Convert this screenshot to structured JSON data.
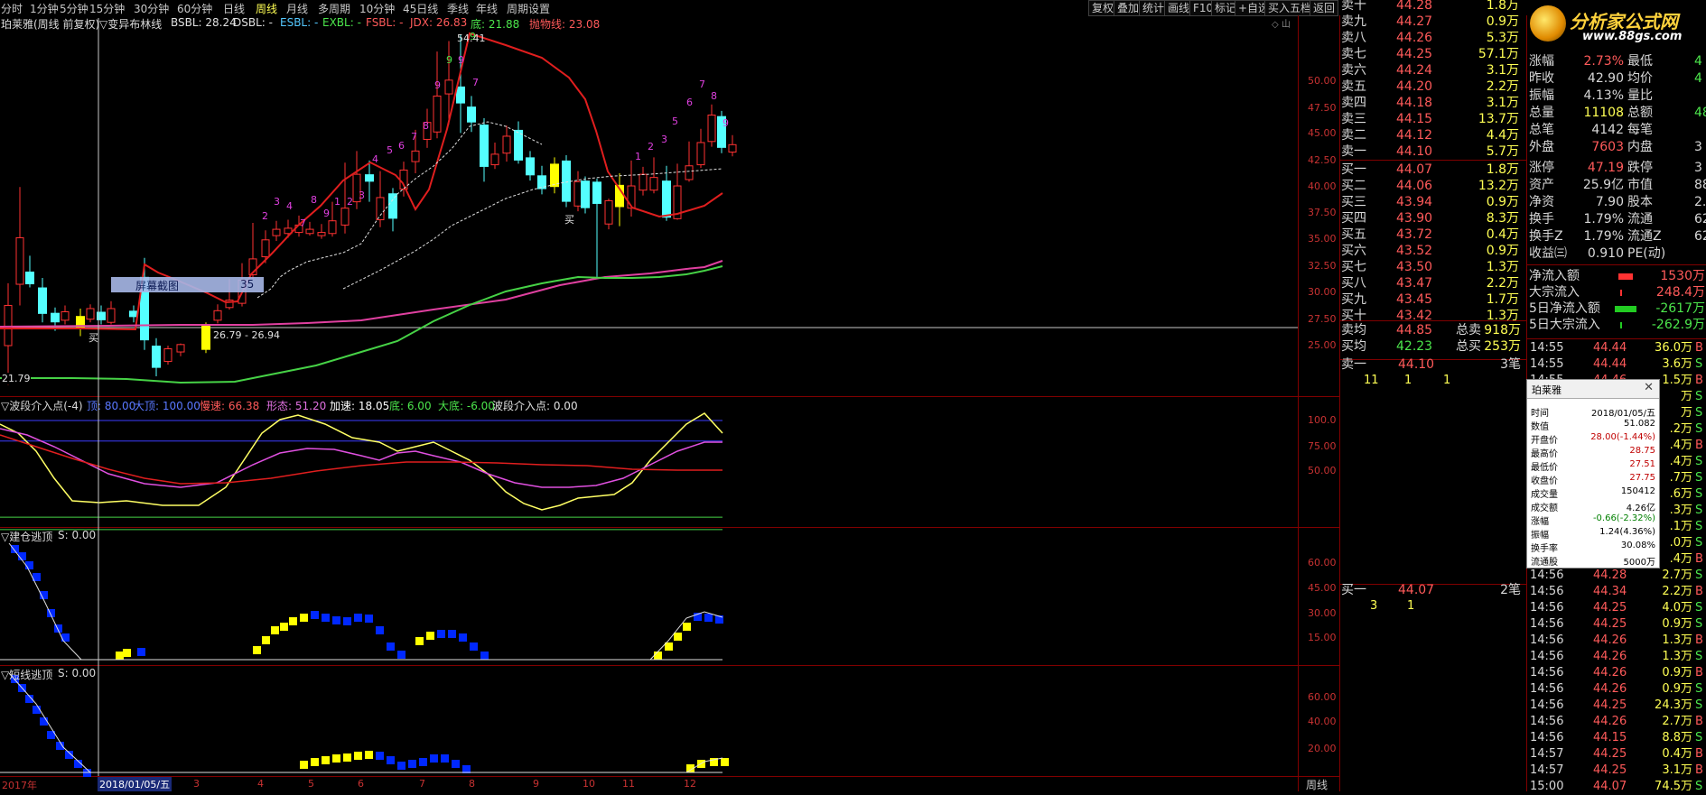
{
  "top_tabs": [
    {
      "label": "分时",
      "active": false
    },
    {
      "label": "1分钟",
      "active": false
    },
    {
      "label": "5分钟",
      "active": false
    },
    {
      "label": "15分钟",
      "active": false
    },
    {
      "label": "30分钟",
      "active": false
    },
    {
      "label": "60分钟",
      "active": false
    },
    {
      "label": "日线",
      "active": false
    },
    {
      "label": "周线",
      "active": true
    },
    {
      "label": "月线",
      "active": false
    },
    {
      "label": "多周期",
      "active": false
    },
    {
      "label": "10分钟",
      "active": false
    },
    {
      "label": "45日线",
      "active": false
    },
    {
      "label": "季线",
      "active": false
    },
    {
      "label": "年线",
      "active": false
    },
    {
      "label": "周期设置",
      "active": false
    }
  ],
  "toolbar": [
    "复权",
    "叠加",
    "统计",
    "画线",
    "F10",
    "标记",
    "+自选",
    "买入五档",
    "返回"
  ],
  "logo": {
    "text": "分析家公式网",
    "url": "www.88gs.com"
  },
  "main_chart": {
    "stock_title": "珀莱雅(周线 前复权)",
    "indicator_name": "▽变异布林线",
    "legend": [
      {
        "text": "BSBL: 28.24",
        "color": "#e0e0e0"
      },
      {
        "text": "DSBL: -",
        "color": "#e0e0e0"
      },
      {
        "text": "ESBL: -",
        "color": "#54c8ff"
      },
      {
        "text": "EXBL: -",
        "color": "#4ce64c"
      },
      {
        "text": "FSBL: -",
        "color": "#ff5a5a"
      },
      {
        "text": "JDX: 26.83",
        "color": "#ff5a5a"
      },
      {
        "text": "底: 21.88",
        "color": "#4ce64c"
      },
      {
        "text": "抛物线: 23.08",
        "color": "#ff5a5a"
      }
    ],
    "y_ticks": [
      "50.00",
      "47.50",
      "45.00",
      "42.50",
      "40.00",
      "37.50",
      "35.00",
      "32.50",
      "30.00",
      "27.50",
      "25.00"
    ],
    "annotations": {
      "high": "54.41",
      "low_label": "21.79",
      "band": "26.79 - 26.94",
      "buy1": "买",
      "buy2": "买",
      "screenshot_label": "屏幕截图",
      "screenshot_value": "35"
    }
  },
  "panel2": {
    "title": "▽波段介入点(-4)",
    "legend": [
      {
        "text": "顶: 80.00",
        "color": "#5a78ff"
      },
      {
        "text": "大顶: 100.00",
        "color": "#5a78ff"
      },
      {
        "text": "慢速: 66.38",
        "color": "#ff5a5a"
      },
      {
        "text": "形态: 51.20",
        "color": "#e070e0"
      },
      {
        "text": "加速: 18.05",
        "color": "#ffffff"
      },
      {
        "text": "底: 6.00",
        "color": "#4ce64c"
      },
      {
        "text": "大底: -6.00",
        "color": "#4ce64c"
      },
      {
        "text": "波段介入点: 0.00",
        "color": "#e0e0e0"
      }
    ],
    "y_ticks": [
      "100.0",
      "75.00",
      "50.00"
    ]
  },
  "panel3": {
    "title": "▽建仓逃顶",
    "value": "S: 0.00",
    "y_ticks": [
      "60.00",
      "45.00",
      "30.00",
      "15.00"
    ]
  },
  "panel4": {
    "title": "▽短线逃顶",
    "value": "S: 0.00",
    "y_ticks": [
      "60.00",
      "40.00",
      "20.00"
    ]
  },
  "x_axis": {
    "start": "2017年",
    "cursor": "2018/01/05/五",
    "labels": [
      "3",
      "4",
      "5",
      "6",
      "7",
      "8",
      "9",
      "10",
      "11",
      "12"
    ],
    "period": "周线"
  },
  "order_book": {
    "sells": [
      {
        "label": "卖十",
        "price": "44.28",
        "vol": "1.8万"
      },
      {
        "label": "卖九",
        "price": "44.27",
        "vol": "0.9万"
      },
      {
        "label": "卖八",
        "price": "44.26",
        "vol": "5.3万"
      },
      {
        "label": "卖七",
        "price": "44.25",
        "vol": "57.1万"
      },
      {
        "label": "卖六",
        "price": "44.24",
        "vol": "3.1万"
      },
      {
        "label": "卖五",
        "price": "44.20",
        "vol": "2.2万"
      },
      {
        "label": "卖四",
        "price": "44.18",
        "vol": "3.1万"
      },
      {
        "label": "卖三",
        "price": "44.15",
        "vol": "13.7万"
      },
      {
        "label": "卖二",
        "price": "44.12",
        "vol": "4.4万"
      },
      {
        "label": "卖一",
        "price": "44.10",
        "vol": "5.7万"
      }
    ],
    "buys": [
      {
        "label": "买一",
        "price": "44.07",
        "vol": "1.8万"
      },
      {
        "label": "买二",
        "price": "44.06",
        "vol": "13.2万"
      },
      {
        "label": "买三",
        "price": "43.94",
        "vol": "0.9万"
      },
      {
        "label": "买四",
        "price": "43.90",
        "vol": "8.3万"
      },
      {
        "label": "买五",
        "price": "43.72",
        "vol": "0.4万"
      },
      {
        "label": "买六",
        "price": "43.52",
        "vol": "0.9万"
      },
      {
        "label": "买七",
        "price": "43.50",
        "vol": "1.3万"
      },
      {
        "label": "买八",
        "price": "43.47",
        "vol": "2.2万"
      },
      {
        "label": "买九",
        "price": "43.45",
        "vol": "1.7万"
      },
      {
        "label": "买十",
        "price": "43.42",
        "vol": "1.3万"
      }
    ],
    "avg_sell": {
      "label": "卖均",
      "price": "44.85",
      "tlabel": "总卖",
      "tval": "918万"
    },
    "avg_buy": {
      "label": "买均",
      "price": "42.23",
      "tlabel": "总买",
      "tval": "253万"
    },
    "queue_sell": {
      "label": "卖一",
      "price": "44.10",
      "count": "3笔",
      "items": [
        "11",
        "1",
        "1"
      ]
    },
    "queue_buy": {
      "label": "买一",
      "price": "44.07",
      "count": "2笔",
      "items": [
        "3",
        "1"
      ]
    }
  },
  "stats": [
    {
      "a": "涨幅",
      "av": "2.73%",
      "b": "最低",
      "bv": "4"
    },
    {
      "a": "昨收",
      "av": "42.90",
      "b": "均价",
      "bv": "4"
    },
    {
      "a": "振幅",
      "av": "4.13%",
      "b": "量比",
      "bv": ""
    },
    {
      "a": "总量",
      "av": "11108",
      "b": "总额",
      "bv": "48"
    },
    {
      "a": "总笔",
      "av": "4142",
      "b": "每笔",
      "bv": ""
    },
    {
      "a": "外盘",
      "av": "7603",
      "b": "内盘",
      "bv": "3"
    },
    {
      "a": "涨停",
      "av": "47.19",
      "b": "跌停",
      "bv": "3"
    },
    {
      "a": "资产",
      "av": "25.9亿",
      "b": "市值",
      "bv": "88"
    },
    {
      "a": "净资",
      "av": "7.90",
      "b": "股本",
      "bv": "2.0"
    },
    {
      "a": "换手",
      "av": "1.79%",
      "b": "流通",
      "bv": "62"
    },
    {
      "a": "换手Z",
      "av": "1.79%",
      "b": "流通Z",
      "bv": "62"
    },
    {
      "a": "收益㈢",
      "av": "0.910",
      "b": "PE(动)",
      "bv": ""
    }
  ],
  "flows": [
    {
      "label": "净流入额",
      "val": "1530万",
      "color": "#ff5a5a"
    },
    {
      "label": "大宗流入",
      "val": "248.4万",
      "color": "#ff5a5a"
    },
    {
      "label": "5日净流入额",
      "val": "-2617万",
      "color": "#4ce64c"
    },
    {
      "label": "5日大宗流入",
      "val": "-262.9万",
      "color": "#4ce64c"
    }
  ],
  "ticks_top": [
    {
      "t": "14:55",
      "p": "44.44",
      "v": "36.0万",
      "s": "B"
    },
    {
      "t": "14:55",
      "p": "44.44",
      "v": "3.6万",
      "s": "S"
    },
    {
      "t": "14:55",
      "p": "44.46",
      "v": "1.5万",
      "s": "B"
    }
  ],
  "ticks_right_peek": [
    {
      "v": "万",
      "s": "S"
    },
    {
      "v": "万",
      "s": "S"
    },
    {
      "v": ".2万",
      "s": "S"
    },
    {
      "v": ".4万",
      "s": "B"
    },
    {
      "v": ".4万",
      "s": "S"
    },
    {
      "v": ".7万",
      "s": "S"
    },
    {
      "v": ".6万",
      "s": "S"
    },
    {
      "v": ".3万",
      "s": "S"
    },
    {
      "v": ".1万",
      "s": "S"
    },
    {
      "v": ".0万",
      "s": "S"
    },
    {
      "v": ".4万",
      "s": "B"
    }
  ],
  "ticks_bottom": [
    {
      "t": "14:56",
      "p": "44.28",
      "v": "2.7万",
      "s": "S"
    },
    {
      "t": "14:56",
      "p": "44.34",
      "v": "2.2万",
      "s": "B"
    },
    {
      "t": "14:56",
      "p": "44.25",
      "v": "4.0万",
      "s": "S"
    },
    {
      "t": "14:56",
      "p": "44.25",
      "v": "0.9万",
      "s": "S"
    },
    {
      "t": "14:56",
      "p": "44.26",
      "v": "1.3万",
      "s": "B"
    },
    {
      "t": "14:56",
      "p": "44.26",
      "v": "1.3万",
      "s": "S"
    },
    {
      "t": "14:56",
      "p": "44.26",
      "v": "0.9万",
      "s": "B"
    },
    {
      "t": "14:56",
      "p": "44.26",
      "v": "0.9万",
      "s": "S"
    },
    {
      "t": "14:56",
      "p": "44.25",
      "v": "24.3万",
      "s": "S"
    },
    {
      "t": "14:56",
      "p": "44.26",
      "v": "2.7万",
      "s": "B"
    },
    {
      "t": "14:56",
      "p": "44.15",
      "v": "8.8万",
      "s": "S"
    },
    {
      "t": "14:57",
      "p": "44.25",
      "v": "0.4万",
      "s": "B"
    },
    {
      "t": "14:57",
      "p": "44.25",
      "v": "3.1万",
      "s": "B"
    },
    {
      "t": "15:00",
      "p": "44.07",
      "v": "74.5万",
      "s": "S"
    }
  ],
  "popup": {
    "title": "珀莱雅",
    "rows": [
      {
        "k": "时间",
        "v": "2018/01/05/五"
      },
      {
        "k": "数值",
        "v": "51.082"
      },
      {
        "k": "开盘价",
        "v": "28.00(-1.44%)"
      },
      {
        "k": "最高价",
        "v": "28.75"
      },
      {
        "k": "最低价",
        "v": "27.51"
      },
      {
        "k": "收盘价",
        "v": "27.75"
      },
      {
        "k": "成交量",
        "v": "150412"
      },
      {
        "k": "成交额",
        "v": "4.26亿"
      },
      {
        "k": "涨幅",
        "v": "-0.66(-2.32%)"
      },
      {
        "k": "振幅",
        "v": "1.24(4.36%)"
      },
      {
        "k": "换手率",
        "v": "30.08%"
      },
      {
        "k": "流通股",
        "v": "5000万"
      }
    ]
  },
  "colors": {
    "grid": "#800000",
    "up": "#ff3232",
    "down": "#54ffff",
    "yellow": "#ffff00",
    "blue": "#0028ff"
  }
}
